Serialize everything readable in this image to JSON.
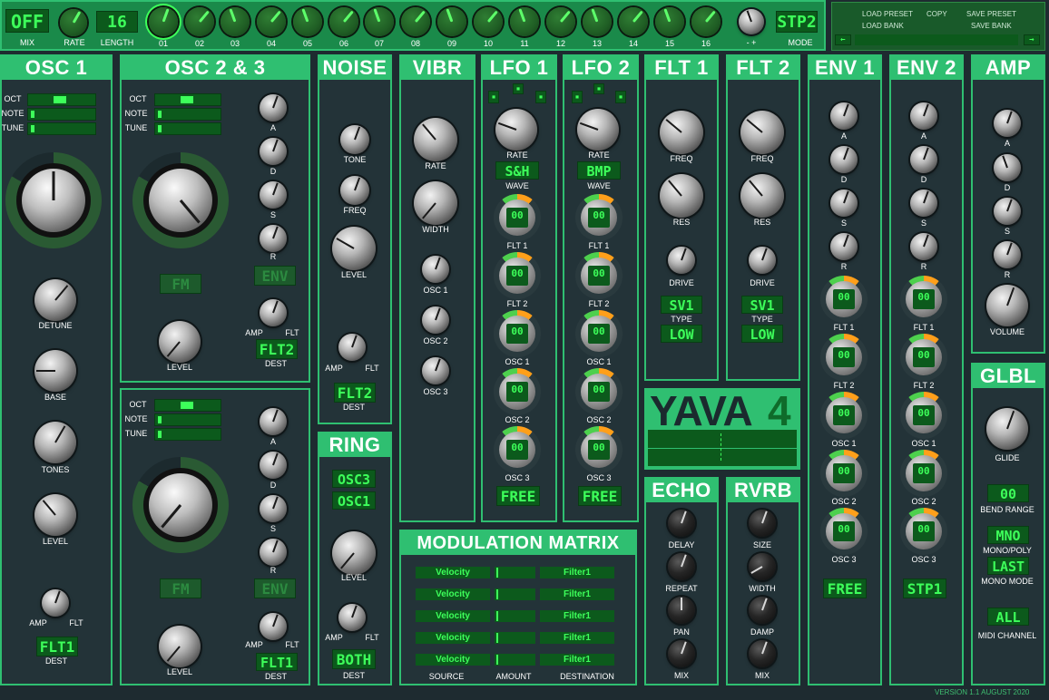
{
  "top_bar": {
    "mix_display": "OFF",
    "mix_label": "MIX",
    "rate_label": "RATE",
    "length_display": "16",
    "length_label": "LENGTH",
    "steps": [
      "01",
      "02",
      "03",
      "04",
      "05",
      "06",
      "07",
      "08",
      "09",
      "10",
      "11",
      "12",
      "13",
      "14",
      "15",
      "16"
    ],
    "mode_minus_plus": "- +",
    "mode_display": "STP2",
    "mode_label": "MODE"
  },
  "preset": {
    "load_preset": "LOAD PRESET",
    "copy": "COPY",
    "save_preset": "SAVE PRESET",
    "load_bank": "LOAD BANK",
    "save_bank": "SAVE BANK",
    "prev_icon": "left-arrow-icon",
    "next_icon": "right-arrow-icon"
  },
  "osc1": {
    "title": "OSC 1",
    "oct": "OCT",
    "note": "NOTE",
    "tune": "TUNE",
    "detune": "DETUNE",
    "base": "BASE",
    "tones": "TONES",
    "level": "LEVEL",
    "amp": "AMP",
    "flt": "FLT",
    "dest_display": "FLT1",
    "dest": "DEST"
  },
  "osc23": {
    "title": "OSC 2 & 3",
    "osc2": {
      "oct": "OCT",
      "note": "NOTE",
      "tune": "TUNE",
      "fm_display": "FM",
      "env_display": "ENV",
      "a": "A",
      "d": "D",
      "s": "S",
      "r": "R",
      "level": "LEVEL",
      "amp": "AMP",
      "flt": "FLT",
      "dest_display": "FLT2",
      "dest": "DEST"
    },
    "osc3": {
      "oct": "OCT",
      "note": "NOTE",
      "tune": "TUNE",
      "fm_display": "FM",
      "env_display": "ENV",
      "a": "A",
      "d": "D",
      "s": "S",
      "r": "R",
      "level": "LEVEL",
      "amp": "AMP",
      "flt": "FLT",
      "dest_display": "FLT1",
      "dest": "DEST"
    }
  },
  "noise": {
    "title": "NOISE",
    "tone": "TONE",
    "freq": "FREQ",
    "level": "LEVEL",
    "amp": "AMP",
    "flt": "FLT",
    "dest_display": "FLT2",
    "dest": "DEST"
  },
  "ring": {
    "title": "RING",
    "src1": "OSC3",
    "src2": "OSC1",
    "level": "LEVEL",
    "amp": "AMP",
    "flt": "FLT",
    "dest_display": "BOTH",
    "dest": "DEST"
  },
  "vibr": {
    "title": "VIBR",
    "rate": "RATE",
    "width": "WIDTH",
    "osc1": "OSC 1",
    "osc2": "OSC 2",
    "osc3": "OSC 3"
  },
  "lfo1": {
    "title": "LFO 1",
    "rate": "RATE",
    "wave_display": "S&H",
    "wave": "WAVE",
    "targets": [
      "FLT 1",
      "FLT 2",
      "OSC 1",
      "OSC 2",
      "OSC 3"
    ],
    "ring_value": "00",
    "mode_display": "FREE"
  },
  "lfo2": {
    "title": "LFO 2",
    "rate": "RATE",
    "wave_display": "BMP",
    "wave": "WAVE",
    "targets": [
      "FLT 1",
      "FLT 2",
      "OSC 1",
      "OSC 2",
      "OSC 3"
    ],
    "ring_value": "00",
    "mode_display": "FREE"
  },
  "flt1": {
    "title": "FLT 1",
    "freq": "FREQ",
    "res": "RES",
    "drive": "DRIVE",
    "type_display": "SV1",
    "type": "TYPE",
    "mode_display": "LOW"
  },
  "flt2": {
    "title": "FLT 2",
    "freq": "FREQ",
    "res": "RES",
    "drive": "DRIVE",
    "type_display": "SV1",
    "type": "TYPE",
    "mode_display": "LOW"
  },
  "logo": {
    "name": "YAVA",
    "num": "4"
  },
  "echo": {
    "title": "ECHO",
    "delay": "DELAY",
    "repeat": "REPEAT",
    "pan": "PAN",
    "mix": "MIX"
  },
  "rvrb": {
    "title": "RVRB",
    "size": "SIZE",
    "width": "WIDTH",
    "damp": "DAMP",
    "mix": "MIX"
  },
  "env1": {
    "title": "ENV 1",
    "a": "A",
    "d": "D",
    "s": "S",
    "r": "R",
    "targets": [
      "FLT 1",
      "FLT 2",
      "OSC 1",
      "OSC 2",
      "OSC 3"
    ],
    "values": [
      "00",
      "00",
      "00",
      "00",
      "00"
    ],
    "mode_display": "FREE"
  },
  "env2": {
    "title": "ENV 2",
    "a": "A",
    "d": "D",
    "s": "S",
    "r": "R",
    "targets": [
      "FLT 1",
      "FLT 2",
      "OSC 1",
      "OSC 2",
      "OSC 3"
    ],
    "values": [
      "00",
      "00",
      "00",
      "00",
      "00"
    ],
    "mode_display": "STP1"
  },
  "amp": {
    "title": "AMP",
    "a": "A",
    "d": "D",
    "s": "S",
    "r": "R",
    "volume": "VOLUME"
  },
  "glbl": {
    "title": "GLBL",
    "glide": "GLIDE",
    "bend_display": "00",
    "bend": "BEND RANGE",
    "monopoly_display": "MNO",
    "monopoly": "MONO/POLY",
    "monomode_display": "LAST",
    "monomode": "MONO MODE",
    "midi_display": "ALL",
    "midi": "MIDI CHANNEL"
  },
  "matrix": {
    "title": "MODULATION MATRIX",
    "rows": [
      {
        "source": "Velocity",
        "dest": "Filter1"
      },
      {
        "source": "Velocity",
        "dest": "Filter1"
      },
      {
        "source": "Velocity",
        "dest": "Filter1"
      },
      {
        "source": "Velocity",
        "dest": "Filter1"
      },
      {
        "source": "Velocity",
        "dest": "Filter1"
      }
    ],
    "source_label": "SOURCE",
    "amount_label": "AMOUNT",
    "destination_label": "DESTINATION"
  },
  "version": "VERSION 1.1 AUGUST 2020"
}
